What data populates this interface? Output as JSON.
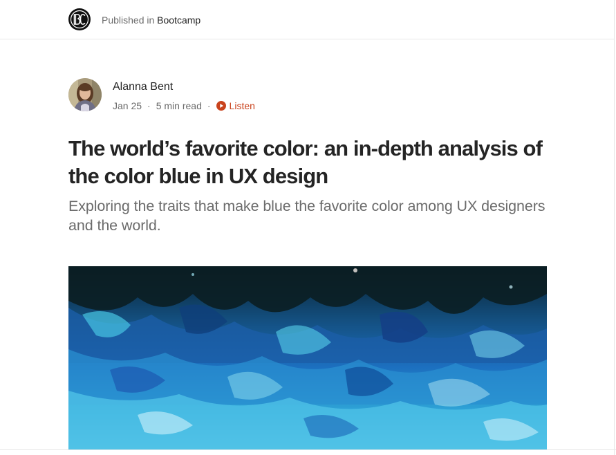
{
  "publication": {
    "prefix": "Published in ",
    "name": "Bootcamp",
    "logo_icon": "bootcamp-bc-logo"
  },
  "author": {
    "name": "Alanna Bent",
    "avatar_icon": "author-avatar"
  },
  "meta": {
    "date": "Jan 25",
    "separator": "·",
    "read_time": "5 min read",
    "listen_label": "Listen",
    "listen_icon": "play-circle-icon"
  },
  "article": {
    "title": "The world’s favorite color: an in-depth analysis of the color blue in UX design",
    "subtitle": "Exploring the traits that make blue the favorite color among UX designers and the world."
  },
  "colors": {
    "accent_listen": "#c9431d",
    "text_primary": "#242424",
    "text_secondary": "#6b6b6b",
    "hero_blue": "#1a5fa8",
    "hero_cyan": "#3fc3e6"
  }
}
